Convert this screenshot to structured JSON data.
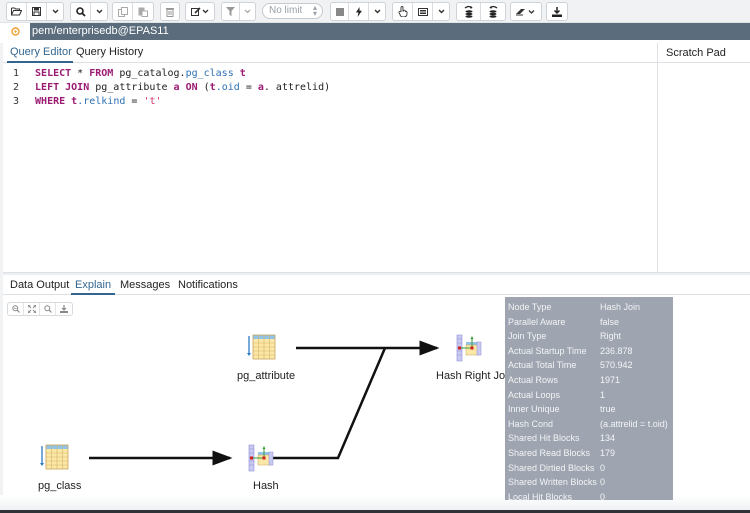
{
  "toolbar": {
    "buttons": [
      {
        "name": "open-file",
        "icon": "folder-open-icon"
      },
      {
        "name": "save-file",
        "icon": "floppy-icon"
      },
      {
        "name": "save-dropdown",
        "icon": "chevron-down-icon"
      },
      {
        "name": "find",
        "icon": "search-icon"
      },
      {
        "name": "find-dropdown",
        "icon": "chevron-down-icon"
      },
      {
        "name": "copy",
        "icon": "copy-icon"
      },
      {
        "name": "paste",
        "icon": "paste-icon"
      },
      {
        "name": "delete",
        "icon": "trash-icon"
      },
      {
        "name": "edit",
        "icon": "edit-icon"
      },
      {
        "name": "filter",
        "icon": "filter-icon"
      },
      {
        "name": "filter-dropdown",
        "icon": "chevron-down-icon"
      },
      {
        "name": "stop",
        "icon": "stop-icon"
      },
      {
        "name": "execute",
        "icon": "bolt-icon"
      },
      {
        "name": "execute-dropdown",
        "icon": "chevron-down-icon"
      },
      {
        "name": "explain",
        "icon": "hand-pointer-icon"
      },
      {
        "name": "explain-analyze",
        "icon": "list-icon"
      },
      {
        "name": "explain-dropdown",
        "icon": "chevron-down-icon"
      },
      {
        "name": "commit",
        "icon": "commit-icon"
      },
      {
        "name": "rollback",
        "icon": "rollback-icon"
      },
      {
        "name": "clear",
        "icon": "eraser-icon"
      },
      {
        "name": "download",
        "icon": "download-icon"
      }
    ],
    "limit_placeholder": "No limit"
  },
  "connection": {
    "status_icon": "connection-status-icon",
    "label": "pem/enterprisedb@EPAS11",
    "status_color": "#f0a030"
  },
  "editor": {
    "tabs": [
      {
        "label": "Query Editor",
        "active": true
      },
      {
        "label": "Query History",
        "active": false
      }
    ],
    "scratch_pad_title": "Scratch Pad",
    "lines": [
      {
        "num": "1",
        "tokens": [
          [
            "kw",
            "SELECT"
          ],
          [
            "plain",
            " * "
          ],
          [
            "kw",
            "FROM"
          ],
          [
            "plain",
            " pg_catalog."
          ],
          [
            "fn",
            "pg_class"
          ],
          [
            "plain",
            " "
          ],
          [
            "kw",
            "t"
          ]
        ]
      },
      {
        "num": "2",
        "tokens": [
          [
            "kw",
            "LEFT JOIN"
          ],
          [
            "plain",
            " pg_attribute "
          ],
          [
            "kw",
            "a"
          ],
          [
            "plain",
            " "
          ],
          [
            "kw",
            "ON"
          ],
          [
            "plain",
            " ("
          ],
          [
            "kw",
            "t"
          ],
          [
            "fn",
            ".oid"
          ],
          [
            "plain",
            " = "
          ],
          [
            "kw",
            "a"
          ],
          [
            "plain",
            ". attrelid)"
          ]
        ]
      },
      {
        "num": "3",
        "tokens": [
          [
            "kw",
            "WHERE"
          ],
          [
            "plain",
            " "
          ],
          [
            "kw",
            "t"
          ],
          [
            "fn",
            ".relkind"
          ],
          [
            "plain",
            " = "
          ],
          [
            "str",
            "'t'"
          ]
        ]
      }
    ]
  },
  "results": {
    "tabs": [
      {
        "label": "Data Output",
        "active": false
      },
      {
        "label": "Explain",
        "active": true
      },
      {
        "label": "Messages",
        "active": false
      },
      {
        "label": "Notifications",
        "active": false
      }
    ],
    "explain_tools": [
      {
        "name": "zoom-in",
        "icon": "zoom-in-icon"
      },
      {
        "name": "zoom-fit",
        "icon": "expand-icon"
      },
      {
        "name": "zoom-out",
        "icon": "zoom-out-icon"
      },
      {
        "name": "download-svg",
        "icon": "download-icon"
      }
    ]
  },
  "plan": {
    "nodes": [
      {
        "id": "pg_attribute",
        "label": "pg_attribute",
        "type": "seq-scan"
      },
      {
        "id": "pg_class",
        "label": "pg_class",
        "type": "seq-scan"
      },
      {
        "id": "hash",
        "label": "Hash",
        "type": "hash"
      },
      {
        "id": "hash_right_join",
        "label": "Hash Right Join",
        "type": "hash-join"
      }
    ],
    "edges": [
      {
        "from": "pg_class",
        "to": "hash"
      },
      {
        "from": "pg_attribute",
        "to": "hash_right_join"
      },
      {
        "from": "hash",
        "to": "hash_right_join"
      }
    ]
  },
  "tooltip": {
    "rows": [
      {
        "key": "Node Type",
        "value": "Hash Join"
      },
      {
        "key": "Parallel Aware",
        "value": "false"
      },
      {
        "key": "Join Type",
        "value": "Right"
      },
      {
        "key": "Actual Startup Time",
        "value": "236.878"
      },
      {
        "key": "Actual Total Time",
        "value": "570.942"
      },
      {
        "key": "Actual Rows",
        "value": "1971"
      },
      {
        "key": "Actual Loops",
        "value": "1"
      },
      {
        "key": "Inner Unique",
        "value": "true"
      },
      {
        "key": "Hash Cond",
        "value": "(a.attrelid = t.oid)"
      },
      {
        "key": "Shared Hit Blocks",
        "value": "134"
      },
      {
        "key": "Shared Read Blocks",
        "value": "179"
      },
      {
        "key": "Shared Dirtied Blocks",
        "value": "0"
      },
      {
        "key": "Shared Written Blocks",
        "value": "0"
      },
      {
        "key": "Local Hit Blocks",
        "value": "0"
      }
    ]
  }
}
